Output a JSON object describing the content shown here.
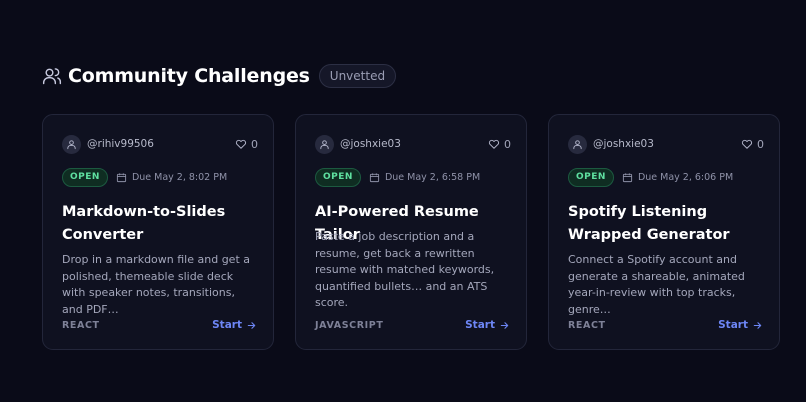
{
  "section": {
    "title": "Community Challenges",
    "badge": "Unvetted"
  },
  "cards": [
    {
      "username": "@rihiv99506",
      "likes": "0",
      "status": "OPEN",
      "due": "Due May 2, 8:02 PM",
      "title": "Markdown-to-Slides Converter",
      "description": "Drop in a markdown file and get a polished, themeable slide deck with speaker notes, transitions, and PDF…",
      "tech": "REACT",
      "action": "Start"
    },
    {
      "username": "@joshxie03",
      "likes": "0",
      "status": "OPEN",
      "due": "Due May 2, 6:58 PM",
      "title": "AI-Powered Resume Tailor",
      "description": "Paste a job description and a resume, get back a rewritten resume with matched keywords, quantified bullets… and an ATS score.",
      "tech": "JAVASCRIPT",
      "action": "Start"
    },
    {
      "username": "@joshxie03",
      "likes": "0",
      "status": "OPEN",
      "due": "Due May 2, 6:06 PM",
      "title": "Spotify Listening Wrapped Generator",
      "description": "Connect a Spotify account and generate a shareable, animated year-in-review with top tracks, genre…",
      "tech": "REACT",
      "action": "Start"
    }
  ],
  "icons": {
    "section": "users-icon",
    "avatar": "user-icon",
    "likes": "heart-icon",
    "due": "calendar-icon",
    "start": "arrow-right-icon"
  },
  "colors": {
    "background": "#0a0b18",
    "card": "#0f1120",
    "open_status": "#5fe0a0",
    "accent": "#6d86f5"
  }
}
